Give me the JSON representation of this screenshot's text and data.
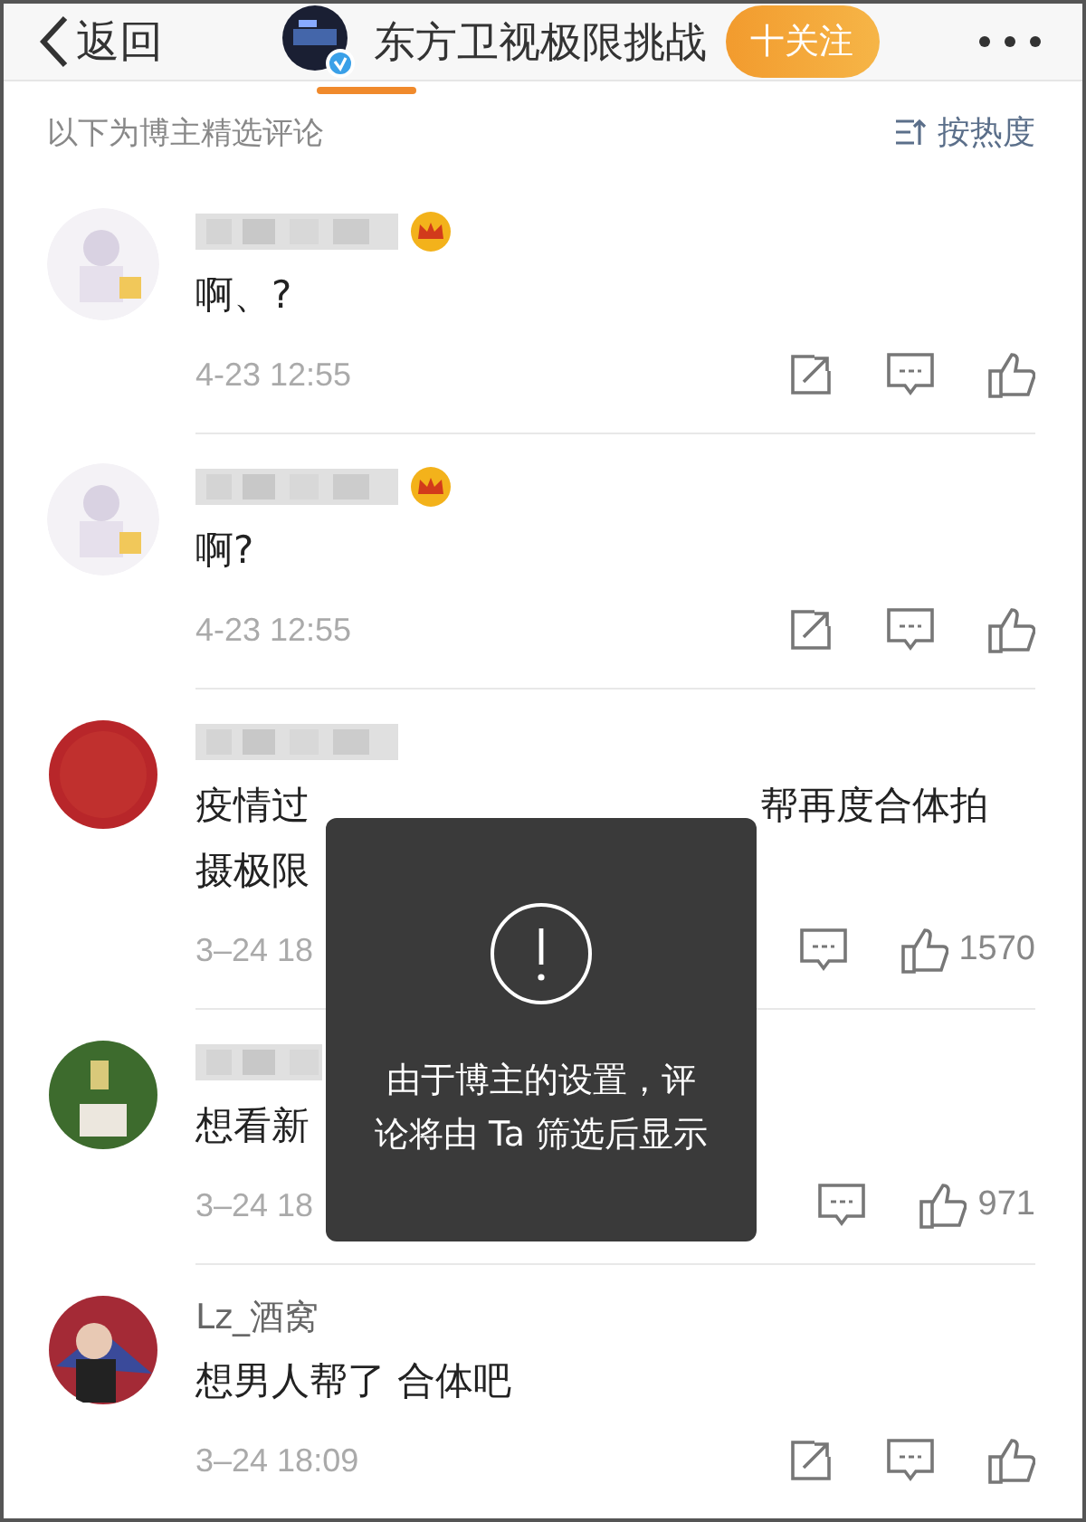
{
  "header": {
    "back": "返回",
    "account": "东方卫视极限挑战",
    "verified": true,
    "follow": "十关注"
  },
  "section": {
    "title": "以下为博主精选评论",
    "sort": "按热度"
  },
  "comments": [
    {
      "crown": true,
      "covered": false,
      "text": "啊、?",
      "time": "4-23 12:55"
    },
    {
      "crown": true,
      "covered": false,
      "text": "啊?",
      "time": "4-23 12:55"
    },
    {
      "crown": false,
      "covered": true,
      "lines": [
        {
          "left": "疫情过",
          "right": "帮再度合体拍"
        },
        {
          "left": "摄极限"
        }
      ],
      "time": "3–24 18",
      "likes": "1570"
    },
    {
      "crown": false,
      "covered": true,
      "lines": [
        {
          "left": "想看新"
        }
      ],
      "time": "3–24 18",
      "likes": "971"
    },
    {
      "crown": false,
      "covered": false,
      "name": "Lz_酒窝",
      "text": "想男人帮了 合体吧",
      "time": "3–24 18:09"
    }
  ],
  "toast": {
    "lines": [
      "由于博主的设置，评",
      "论将由 Ta 筛选后显示"
    ]
  }
}
